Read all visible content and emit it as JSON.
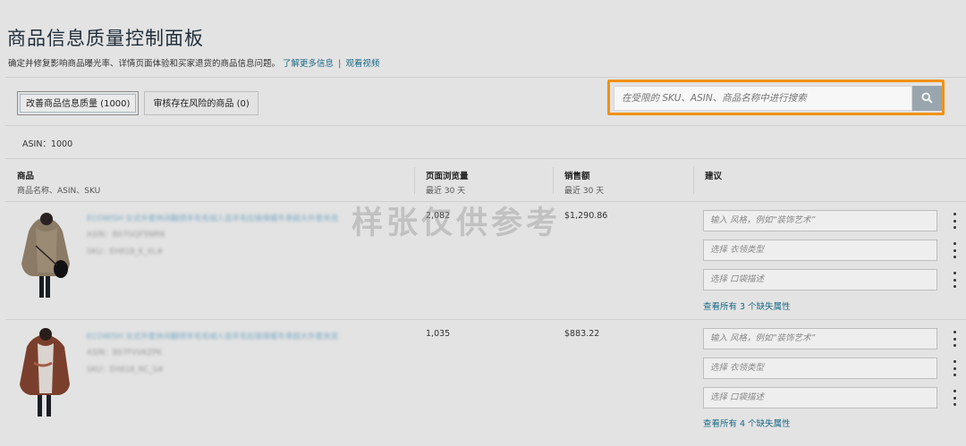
{
  "header": {
    "title": "商品信息质量控制面板",
    "description": "确定并修复影响商品曝光率、详情页面体验和买家退货的商品信息问题。",
    "learn_more": "了解更多信息",
    "separator": "|",
    "watch_video": "观看视频"
  },
  "tabs": [
    {
      "label": "改善商品信息质量 (1000)",
      "active": true
    },
    {
      "label": "审核存在风险的商品 (0)",
      "active": false
    }
  ],
  "search": {
    "placeholder": "在受限的 SKU、ASIN、商品名称中进行搜索",
    "icon": "search-icon",
    "highlight_color": "#f29211"
  },
  "count_label": "ASIN：1000",
  "columns": {
    "product": {
      "title": "商品",
      "subtitle": "商品名称、ASIN、SKU"
    },
    "page_views": {
      "title": "页面浏览量",
      "subtitle": "最近 30 天"
    },
    "sales": {
      "title": "销售额",
      "subtitle": "最近 30 天"
    },
    "suggestions": {
      "title": "建议"
    }
  },
  "rows": [
    {
      "name": "ECOWISH 女式外套休闲翻领羊毛毛绒人造羊毛拉链保暖冬季超大外套夹克",
      "asin": "ASIN：B07GQF5NRN",
      "sku": "SKU：EH818_K_XL#",
      "page_views": "2,082",
      "sales": "$1,290.86",
      "fields": [
        "输入 风格，例如“装饰艺术”",
        "选择 衣领类型",
        "选择 口袋描述"
      ],
      "more": "查看所有 3 个缺失属性"
    },
    {
      "name": "ECOWISH 女式外套休闲翻领羊毛毛绒人造羊毛拉链保暖冬季超大外套夹克",
      "asin": "ASIN：B07FVVKZPK",
      "sku": "SKU：EH818_RC_S#",
      "page_views": "1,035",
      "sales": "$883.22",
      "fields": [
        "输入 风格，例如“装饰艺术”",
        "选择 衣领类型",
        "选择 口袋描述"
      ],
      "more": "查看所有 4 个缺失属性"
    }
  ],
  "watermark": "样张仅供参考"
}
